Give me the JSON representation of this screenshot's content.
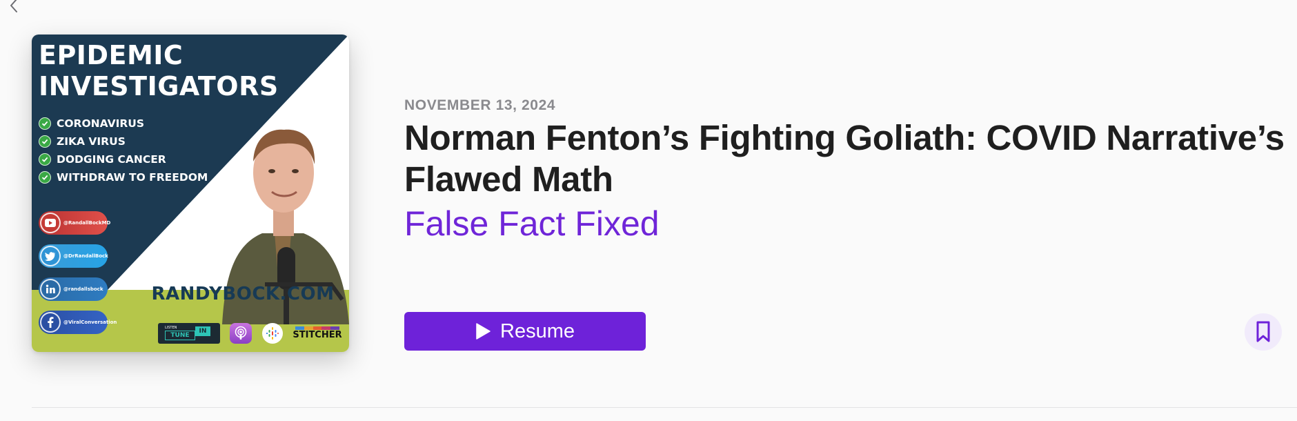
{
  "nav": {
    "back_icon": "chevron-left-icon"
  },
  "artwork": {
    "title": "EPIDEMIC\nINVESTIGATORS",
    "topics": [
      "CORONAVIRUS",
      "ZIKA VIRUS",
      "DODGING CANCER",
      "WITHDRAW TO FREEDOM"
    ],
    "social": [
      {
        "icon": "youtube-icon",
        "handle": "@RandallBockMD"
      },
      {
        "icon": "twitter-icon",
        "handle": "@DrRandallBock"
      },
      {
        "icon": "linkedin-icon",
        "handle": "@randallsbock"
      },
      {
        "icon": "facebook-icon",
        "handle": "@ViralConversation"
      }
    ],
    "website": "RANDYBOCK.COM",
    "platforms": {
      "tunein_small": "LISTEN",
      "tunein_word": "TUNE",
      "tunein_in": "IN",
      "apple_icon": "apple-podcasts-icon",
      "google_icon": "google-podcasts-icon",
      "stitcher": "STITCHER"
    },
    "colors": {
      "navy": "#1c3a52",
      "lime": "#b5c64a"
    }
  },
  "episode": {
    "date": "NOVEMBER 13, 2024",
    "title": "Norman Fenton’s Fighting Goliath: COVID Narrative’s Flawed Math",
    "show": "False Fact Fixed"
  },
  "actions": {
    "resume_label": "Resume",
    "play_icon": "play-icon",
    "bookmark_icon": "bookmark-icon"
  },
  "theme": {
    "accent": "#6e22d9",
    "accent_light": "#f1ebfb",
    "text": "#1f1f1f",
    "muted": "#8a8a8e"
  }
}
